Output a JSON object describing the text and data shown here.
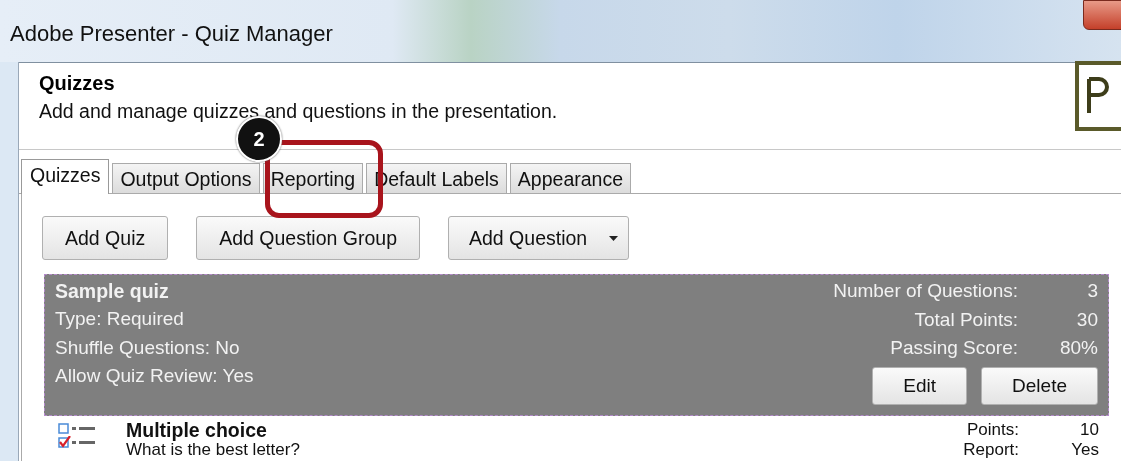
{
  "window": {
    "title": "Adobe Presenter - Quiz Manager"
  },
  "header": {
    "title": "Quizzes",
    "description": "Add and manage quizzes and questions in the presentation."
  },
  "callout": {
    "number": "2"
  },
  "tabs": [
    {
      "label": "Quizzes",
      "selected": true
    },
    {
      "label": "Output Options",
      "selected": false
    },
    {
      "label": "Reporting",
      "selected": false
    },
    {
      "label": "Default Labels",
      "selected": false
    },
    {
      "label": "Appearance",
      "selected": false
    }
  ],
  "toolbar": [
    {
      "label": "Add Quiz",
      "dropdown": false
    },
    {
      "label": "Add Question Group",
      "dropdown": false
    },
    {
      "label": "Add Question",
      "dropdown": true
    }
  ],
  "quiz": {
    "name": "Sample quiz",
    "selected": true,
    "details": [
      "Type: Required",
      "Shuffle Questions: No",
      "Allow Quiz Review: Yes"
    ],
    "stats": [
      {
        "label": "Number of Questions:",
        "value": "3"
      },
      {
        "label": "Total Points:",
        "value": "30"
      },
      {
        "label": "Passing Score:",
        "value": "80%"
      }
    ],
    "buttons": [
      "Edit",
      "Delete"
    ]
  },
  "questions": [
    {
      "type": "Multiple choice",
      "text": "What is the best letter?",
      "stats": [
        {
          "label": "Points:",
          "value": "10"
        },
        {
          "label": "Report:",
          "value": "Yes"
        }
      ]
    }
  ]
}
